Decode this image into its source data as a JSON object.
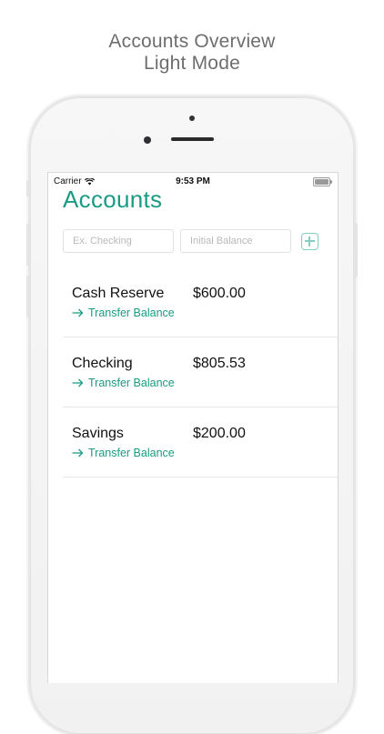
{
  "caption": {
    "line1": "Accounts Overview",
    "line2": "Light Mode"
  },
  "status_bar": {
    "carrier": "Carrier",
    "time": "9:53 PM",
    "icons": [
      "wifi-icon",
      "battery-icon"
    ]
  },
  "page": {
    "title": "Accounts"
  },
  "form": {
    "name_placeholder": "Ex. Checking",
    "name_value": "",
    "balance_placeholder": "Initial Balance",
    "balance_value": "",
    "add_icon": "plus-square-icon"
  },
  "accounts": [
    {
      "name": "Cash Reserve",
      "balance": "$600.00",
      "action": "Transfer Balance"
    },
    {
      "name": "Checking",
      "balance": "$805.53",
      "action": "Transfer Balance"
    },
    {
      "name": "Savings",
      "balance": "$200.00",
      "action": "Transfer Balance"
    }
  ],
  "colors": {
    "accent": "#199b84",
    "add_button": "#7fd0c1"
  }
}
